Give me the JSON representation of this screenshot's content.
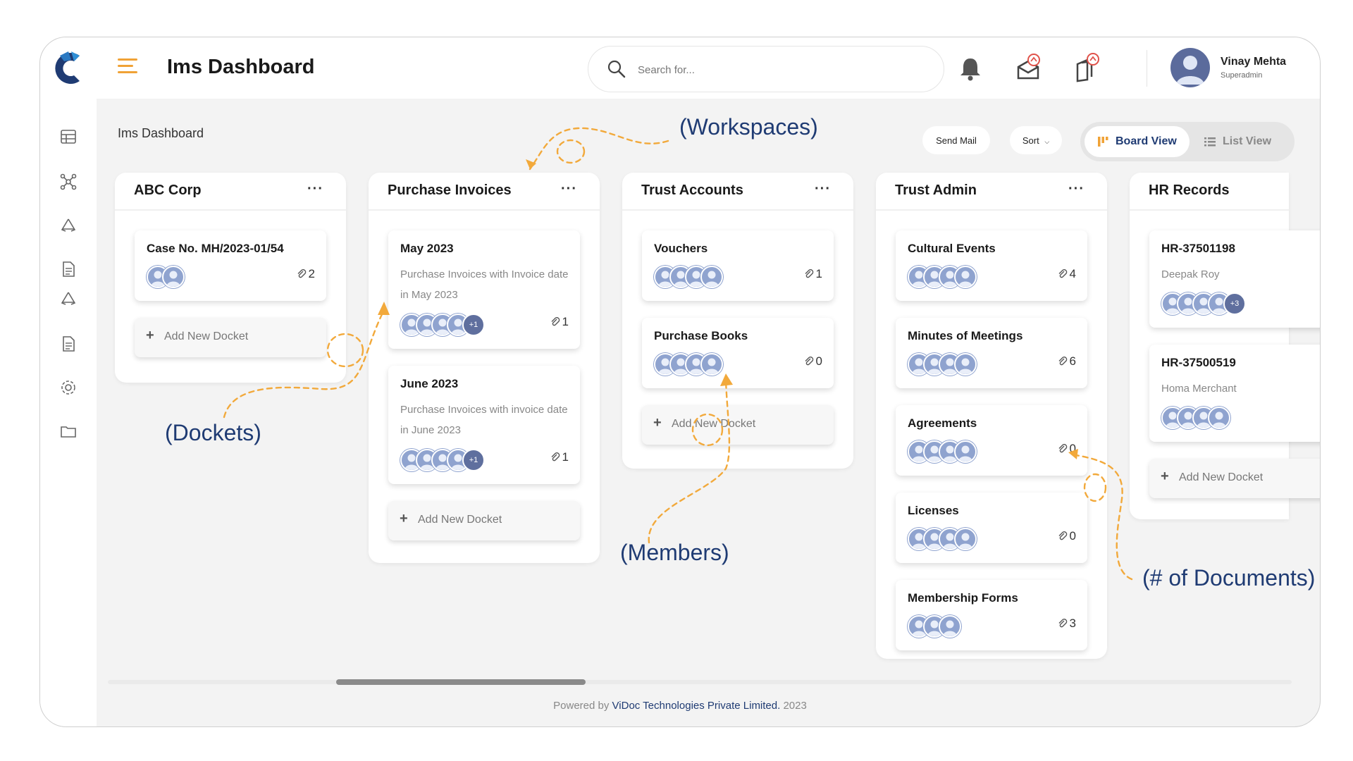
{
  "header": {
    "title": "Ims Dashboard",
    "search_placeholder": "Search for...",
    "user": {
      "name": "Vinay Mehta",
      "role": "Superadmin"
    }
  },
  "breadcrumb": "Ims Dashboard",
  "toolbar": {
    "send_mail": "Send Mail",
    "sort": "Sort",
    "board_view": "Board View",
    "list_view": "List View"
  },
  "columns": [
    {
      "title": "ABC Corp",
      "menu": "···",
      "dockets": [
        {
          "title": "Case No. MH/2023-01/54",
          "description": "",
          "members": 2,
          "more": "",
          "docs": "2"
        }
      ],
      "add_label": "Add New Docket"
    },
    {
      "title": "Purchase Invoices",
      "menu": "···",
      "dockets": [
        {
          "title": "May 2023",
          "description": "Purchase Invoices with Invoice date in May 2023",
          "members": 4,
          "more": "+1",
          "docs": "1"
        },
        {
          "title": "June 2023",
          "description": "Purchase Invoices with invoice date in June 2023",
          "members": 4,
          "more": "+1",
          "docs": "1"
        }
      ],
      "add_label": "Add New Docket"
    },
    {
      "title": "Trust Accounts",
      "menu": "···",
      "dockets": [
        {
          "title": "Vouchers",
          "description": "",
          "members": 4,
          "more": "",
          "docs": "1"
        },
        {
          "title": "Purchase Books",
          "description": "",
          "members": 4,
          "more": "",
          "docs": "0"
        }
      ],
      "add_label": "Add New Docket"
    },
    {
      "title": "Trust Admin",
      "menu": "···",
      "dockets": [
        {
          "title": "Cultural Events",
          "description": "",
          "members": 4,
          "more": "",
          "docs": "4"
        },
        {
          "title": "Minutes of Meetings",
          "description": "",
          "members": 4,
          "more": "",
          "docs": "6"
        },
        {
          "title": "Agreements",
          "description": "",
          "members": 4,
          "more": "",
          "docs": "0"
        },
        {
          "title": "Licenses",
          "description": "",
          "members": 4,
          "more": "",
          "docs": "0"
        },
        {
          "title": "Membership Forms",
          "description": "",
          "members": 3,
          "more": "",
          "docs": "3"
        }
      ],
      "add_label": ""
    },
    {
      "title": "HR Records",
      "menu": "",
      "dockets": [
        {
          "title": "HR-37501198",
          "description": "Deepak Roy",
          "members": 4,
          "more": "+3",
          "docs": ""
        },
        {
          "title": "HR-37500519",
          "description": "Homa Merchant",
          "members": 4,
          "more": "",
          "docs": ""
        }
      ],
      "add_label": "Add New Docket"
    }
  ],
  "footer": {
    "prefix": "Powered by",
    "company": "ViDoc Technologies Private Limited.",
    "year": "2023"
  },
  "annotations": {
    "workspaces": "(Workspaces)",
    "dockets": "(Dockets)",
    "members": "(Members)",
    "documents": "(# of Documents)"
  },
  "colors": {
    "brand": "#1f3b73",
    "accent": "#f0a236",
    "avatar": "#8fa3cf"
  },
  "icons": [
    "logo-icon",
    "menu-icon",
    "search-icon",
    "bell-icon",
    "mail-alert-icon",
    "document-alert-icon",
    "dashboard-icon",
    "network-icon",
    "recycle-icon",
    "file-icon",
    "settings-icon",
    "folder-icon",
    "moon-icon",
    "board-icon",
    "list-icon",
    "paperclip-icon",
    "user-avatar-icon"
  ]
}
